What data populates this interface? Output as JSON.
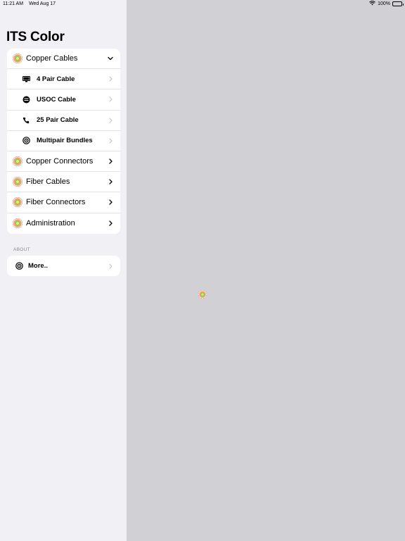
{
  "status_bar": {
    "time": "11:21 AM",
    "date": "Wed Aug 17",
    "battery": "100%"
  },
  "sidebar": {
    "title": "ITS Color",
    "items": [
      {
        "label": "Copper Cables",
        "icon": "its-color-logo-icon",
        "expanded": true,
        "children": [
          {
            "label": "4 Pair Cable",
            "icon": "monitor-icon"
          },
          {
            "label": "USOC Cable",
            "icon": "usoc-icon"
          },
          {
            "label": "25 Pair Cable",
            "icon": "phone-icon"
          },
          {
            "label": "Multipair Bundles",
            "icon": "target-icon"
          }
        ]
      },
      {
        "label": "Copper Connectors",
        "icon": "its-color-logo-icon"
      },
      {
        "label": "Fiber Cables",
        "icon": "its-color-logo-icon"
      },
      {
        "label": "Fiber Connectors",
        "icon": "its-color-logo-icon"
      },
      {
        "label": "Administration",
        "icon": "its-color-logo-icon"
      }
    ],
    "about_header": "ABOUT",
    "about_items": [
      {
        "label": "More..",
        "icon": "target-icon"
      }
    ]
  },
  "colors": {
    "sidebar_bg": "#f1f0f5",
    "detail_bg": "#d1d0d4",
    "logo_outer": "#e0352b"
  }
}
